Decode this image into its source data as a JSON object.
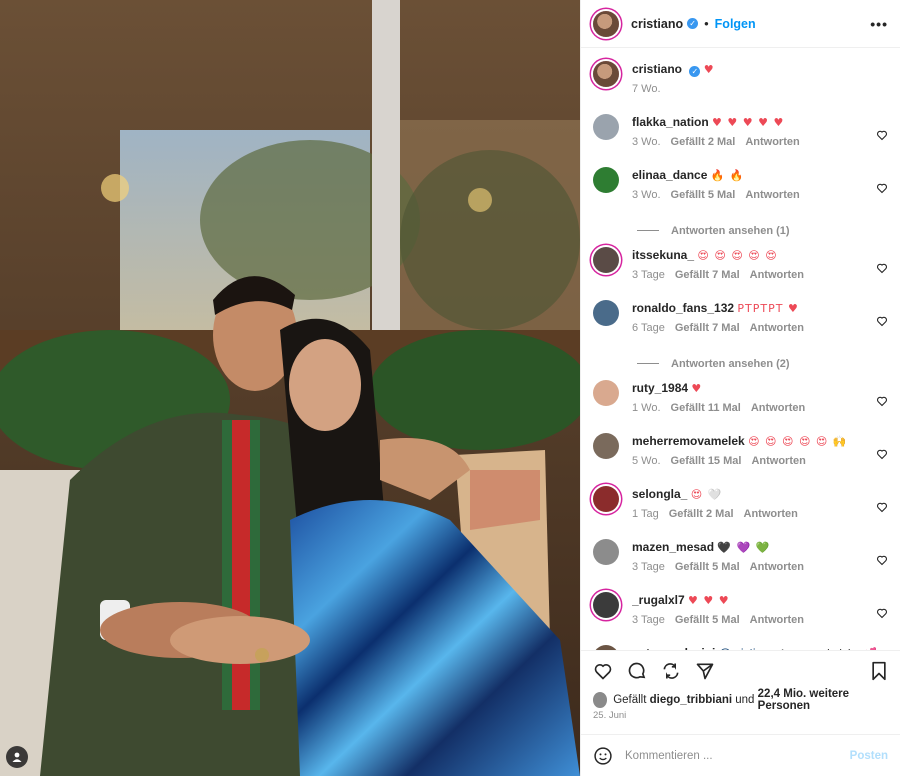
{
  "post": {
    "author": "cristiano",
    "follow_label": "Folgen",
    "more_label": "•••",
    "dot": "•"
  },
  "caption": {
    "user": "cristiano",
    "text": "♥",
    "time": "7 Wo."
  },
  "comments": [
    {
      "user": "flakka_nation",
      "text": "♥ ♥ ♥ ♥ ♥",
      "time": "3 Wo.",
      "likes": "Gefällt 2 Mal",
      "reply": "Antworten",
      "color": "#9aa3ad"
    },
    {
      "user": "elinaa_dance",
      "text": "🔥 🔥",
      "time": "3 Wo.",
      "likes": "Gefällt 5 Mal",
      "reply": "Antworten",
      "color": "#2e7d32",
      "view_replies": "Antworten ansehen (1)"
    },
    {
      "user": "itssekuna_",
      "text": "😍 😍 😍 😍 😍",
      "time": "3 Tage",
      "likes": "Gefällt 7 Mal",
      "reply": "Antworten",
      "color": "#5a4b46",
      "story": true
    },
    {
      "user": "ronaldo_fans_132",
      "text": "PTPTPT ♥",
      "time": "6 Tage",
      "likes": "Gefällt 7 Mal",
      "reply": "Antworten",
      "color": "#4a6b8a",
      "view_replies": "Antworten ansehen (2)"
    },
    {
      "user": "ruty_1984",
      "text": "♥",
      "time": "1 Wo.",
      "likes": "Gefällt 11 Mal",
      "reply": "Antworten",
      "color": "#d9a98f"
    },
    {
      "user": "meherremovamelek",
      "text": "😍 😍 😍 😍 😍 🙌",
      "time": "5 Wo.",
      "likes": "Gefällt 15 Mal",
      "reply": "Antworten",
      "color": "#7a6a5c"
    },
    {
      "user": "selongla_",
      "text": "😍 🤍",
      "time": "1 Tag",
      "likes": "Gefällt 2 Mal",
      "reply": "Antworten",
      "color": "#8b2c2c",
      "story": true
    },
    {
      "user": "mazen_mesad",
      "text": "🖤 💜 💚",
      "time": "3 Tage",
      "likes": "Gefällt 5 Mal",
      "reply": "Antworten",
      "color": "#8c8c8c"
    },
    {
      "user": "_rugalxl7",
      "text": "♥ ♥ ♥",
      "time": "3 Tage",
      "likes": "Gefällt 5 Mal",
      "reply": "Antworten",
      "color": "#3b3b3b",
      "story": true
    },
    {
      "user": "anton_ashwini",
      "mention": "@cristiano",
      "text": "Amor verdadeiro 💕",
      "time": "",
      "likes": "",
      "reply": "",
      "color": "#6b5544"
    }
  ],
  "likes_line": {
    "prefix": "Gefällt",
    "user": "diego_tribbiani",
    "middle": "und",
    "count": "22,4 Mio. weitere Personen"
  },
  "date": "25. Juni",
  "composer": {
    "placeholder": "Kommentieren ...",
    "post_label": "Posten"
  },
  "colors": {
    "accent": "#0095f6",
    "heart": "#ed4956",
    "muted": "#8e8e8e",
    "story_ring": "#d6249f"
  },
  "icons": [
    "heart-icon",
    "comment-icon",
    "share-icon",
    "send-icon",
    "bookmark-icon",
    "emoji-icon",
    "tag-user-icon",
    "verified-icon",
    "more-icon"
  ]
}
